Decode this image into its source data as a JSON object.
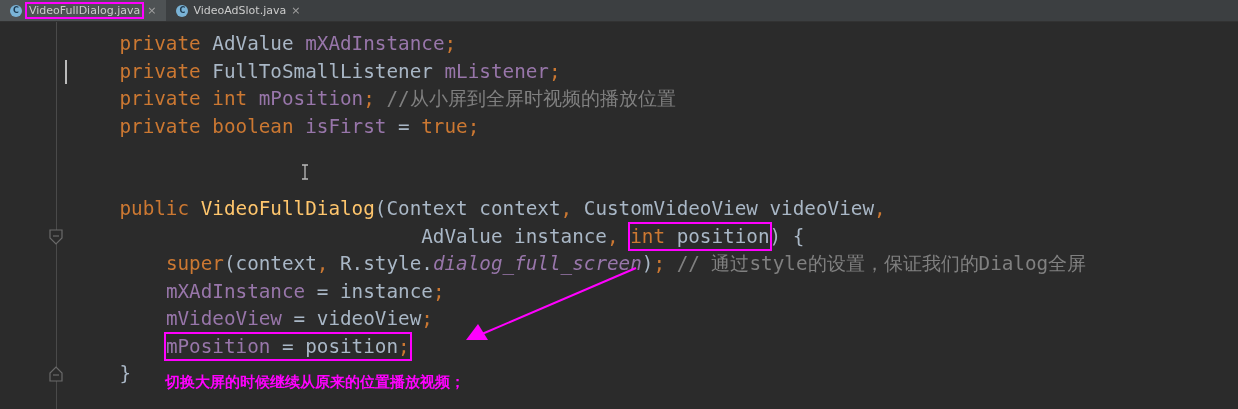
{
  "tabs": [
    {
      "label": "VideoFullDialog.java",
      "icon_letter": "C",
      "close": "×",
      "selected": true
    },
    {
      "label": "VideoAdSlot.java",
      "icon_letter": "C",
      "close": "×",
      "selected": false
    }
  ],
  "lines": [
    {
      "kind": "code",
      "caret": false,
      "parts": [
        {
          "boxed": false,
          "tokens": [
            {
              "t": "    private ",
              "kind": "keyword"
            },
            {
              "t": "AdValue ",
              "kind": "plain"
            },
            {
              "t": "mXAdInstance",
              "kind": "field"
            },
            {
              "t": ";",
              "kind": "punct"
            }
          ]
        }
      ]
    },
    {
      "kind": "code",
      "caret": true,
      "parts": [
        {
          "boxed": false,
          "tokens": [
            {
              "t": "    private ",
              "kind": "keyword"
            },
            {
              "t": "FullToSmallListener ",
              "kind": "plain"
            },
            {
              "t": "mListener",
              "kind": "field"
            },
            {
              "t": ";",
              "kind": "punct"
            }
          ]
        }
      ]
    },
    {
      "kind": "code",
      "caret": false,
      "parts": [
        {
          "boxed": false,
          "tokens": [
            {
              "t": "    private int ",
              "kind": "keyword"
            },
            {
              "t": "mPosition",
              "kind": "field"
            },
            {
              "t": "; ",
              "kind": "punct"
            },
            {
              "t": "//从小屏到全屏时视频的播放位置",
              "kind": "comment"
            }
          ]
        }
      ]
    },
    {
      "kind": "code",
      "caret": false,
      "parts": [
        {
          "boxed": false,
          "tokens": [
            {
              "t": "    private boolean ",
              "kind": "keyword"
            },
            {
              "t": "isFirst ",
              "kind": "field"
            },
            {
              "t": "= ",
              "kind": "plain"
            },
            {
              "t": "true",
              "kind": "keyword"
            },
            {
              "t": ";",
              "kind": "punct"
            }
          ]
        }
      ]
    },
    {
      "kind": "blank",
      "caret": false
    },
    {
      "kind": "blank",
      "caret": false
    },
    {
      "kind": "code",
      "caret": false,
      "parts": [
        {
          "boxed": false,
          "tokens": [
            {
              "t": "    public ",
              "kind": "keyword"
            },
            {
              "t": "VideoFullDialog",
              "kind": "method"
            },
            {
              "t": "(Context context",
              "kind": "plain"
            },
            {
              "t": ", ",
              "kind": "punct"
            },
            {
              "t": "CustomVideoView videoView",
              "kind": "plain"
            },
            {
              "t": ",",
              "kind": "punct"
            }
          ]
        }
      ]
    },
    {
      "kind": "code",
      "caret": false,
      "fold": {
        "kind": "start"
      },
      "parts": [
        {
          "boxed": false,
          "tokens": [
            {
              "t": "                              AdValue instance",
              "kind": "plain"
            },
            {
              "t": ", ",
              "kind": "punct"
            }
          ]
        },
        {
          "boxed": true,
          "tokens": [
            {
              "t": "int ",
              "kind": "keyword"
            },
            {
              "t": "position",
              "kind": "plain"
            }
          ]
        },
        {
          "boxed": false,
          "tokens": [
            {
              "t": ") {",
              "kind": "plain"
            }
          ]
        }
      ]
    },
    {
      "kind": "code",
      "caret": false,
      "parts": [
        {
          "boxed": false,
          "tokens": [
            {
              "t": "        super",
              "kind": "keyword"
            },
            {
              "t": "(context",
              "kind": "plain"
            },
            {
              "t": ", ",
              "kind": "punct"
            },
            {
              "t": "R.style.",
              "kind": "plain"
            },
            {
              "t": "dialog_full_screen",
              "kind": "static"
            },
            {
              "t": ")",
              "kind": "plain"
            },
            {
              "t": "; ",
              "kind": "punct"
            },
            {
              "t": "// 通过style的设置，保证我们的Dialog全屏",
              "kind": "comment"
            }
          ]
        }
      ]
    },
    {
      "kind": "code",
      "caret": false,
      "parts": [
        {
          "boxed": false,
          "tokens": [
            {
              "t": "        mXAdInstance ",
              "kind": "field"
            },
            {
              "t": "= instance",
              "kind": "plain"
            },
            {
              "t": ";",
              "kind": "punct"
            }
          ]
        }
      ]
    },
    {
      "kind": "code",
      "caret": false,
      "parts": [
        {
          "boxed": false,
          "tokens": [
            {
              "t": "        mVideoView ",
              "kind": "field"
            },
            {
              "t": "= videoView",
              "kind": "plain"
            },
            {
              "t": ";",
              "kind": "punct"
            }
          ]
        }
      ]
    },
    {
      "kind": "code",
      "caret": false,
      "parts": [
        {
          "boxed": true,
          "tokens": [
            {
              "t": "        mPosition ",
              "kind": "field"
            },
            {
              "t": "= position",
              "kind": "plain"
            },
            {
              "t": ";",
              "kind": "punct"
            }
          ]
        }
      ]
    },
    {
      "kind": "code",
      "caret": false,
      "fold": {
        "kind": "end"
      },
      "parts": [
        {
          "boxed": false,
          "tokens": [
            {
              "t": "    }",
              "kind": "plain"
            }
          ]
        }
      ]
    }
  ],
  "annotation": {
    "text": "切换大屏的时候继续从原来的位置播放视频；"
  }
}
